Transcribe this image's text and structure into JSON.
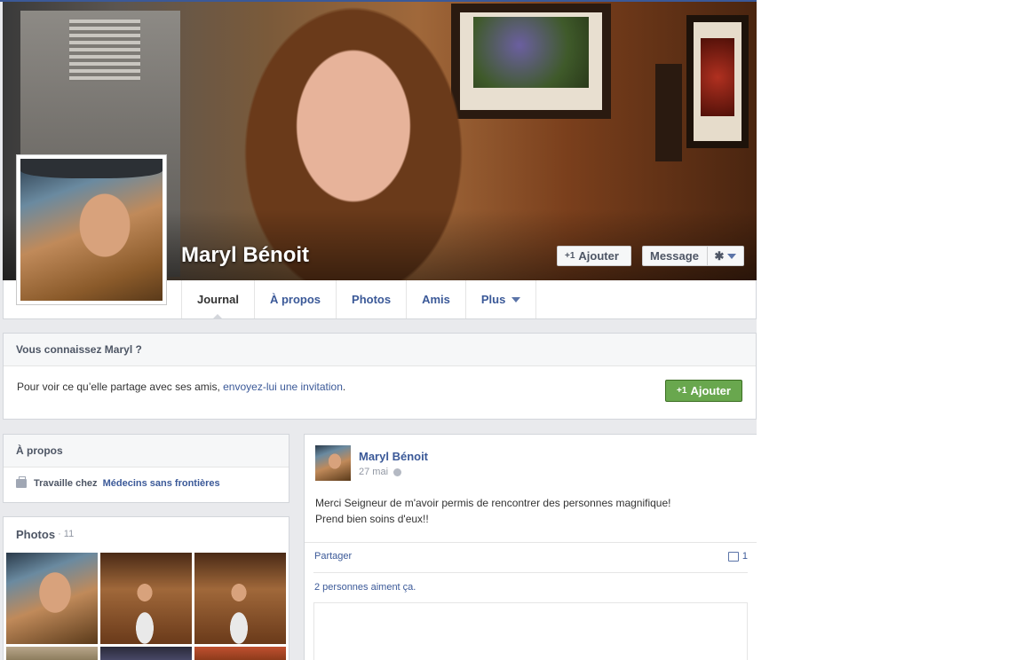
{
  "profile": {
    "name": "Maryl Bénoit",
    "add_label": "Ajouter",
    "plus_one": "+1",
    "message_label": "Message",
    "gear_icon": "gear-icon"
  },
  "tabs": [
    {
      "label": "Journal"
    },
    {
      "label": "À propos"
    },
    {
      "label": "Photos"
    },
    {
      "label": "Amis"
    },
    {
      "label": "Plus"
    }
  ],
  "know_box": {
    "title": "Vous connaissez Maryl ?",
    "text_before": "Pour voir ce qu’elle partage avec ses amis, ",
    "link": "envoyez-lui une invitation",
    "text_after": ".",
    "add_label": "Ajouter"
  },
  "about": {
    "title": "À propos",
    "work_prefix": "Travaille chez ",
    "work_place": "Médecins sans frontières"
  },
  "photos": {
    "title": "Photos",
    "count": "· 11"
  },
  "post": {
    "author": "Maryl Bénoit",
    "date": "27 mai",
    "line1": "Merci Seigneur de m'avoir permis de rencontrer des personnes magnifique!",
    "line2": "Prend bien soins d'eux!!",
    "share_label": "Partager",
    "comment_count": "1",
    "likes": "2 personnes aiment ça."
  }
}
